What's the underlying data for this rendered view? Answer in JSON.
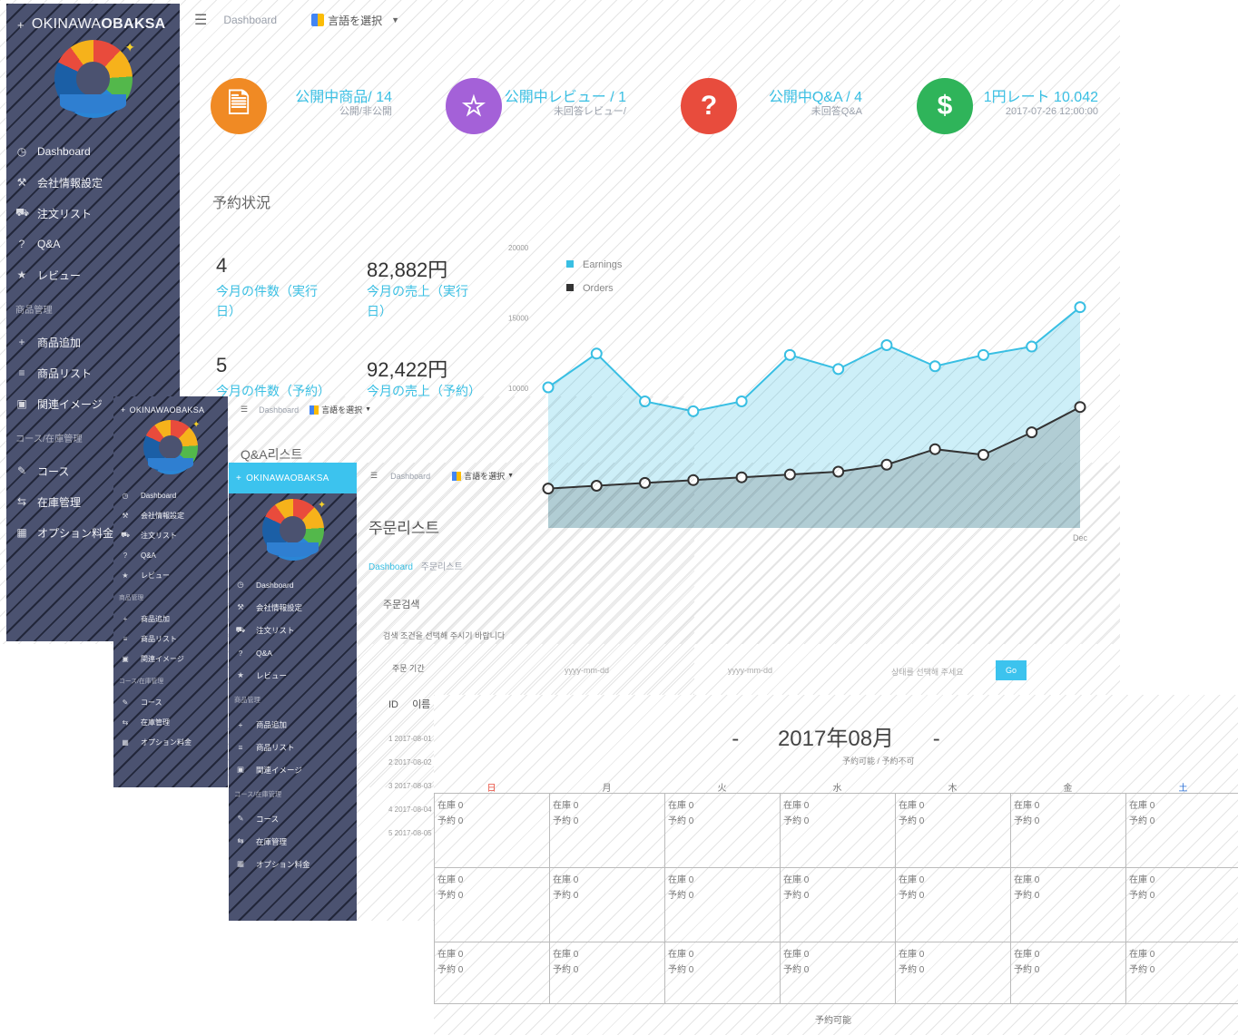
{
  "dash": {
    "brand_prefix": "OKINAWA",
    "brand_bold": "OBAKSA",
    "topbar": {
      "breadcrumb": "Dashboard",
      "language": "言語を選択"
    },
    "nav": [
      {
        "icon": "clock-icon",
        "label": "Dashboard"
      },
      {
        "icon": "wrench-icon",
        "label": "会社情報設定"
      },
      {
        "icon": "cart-icon",
        "label": "注文リスト"
      },
      {
        "icon": "question-icon",
        "label": "Q&A"
      },
      {
        "icon": "star-icon",
        "label": "レビュー"
      }
    ],
    "section_goods": "商品管理",
    "nav2": [
      {
        "icon": "plus-icon",
        "label": "商品追加"
      },
      {
        "icon": "list-icon",
        "label": "商品リスト"
      },
      {
        "icon": "image-icon",
        "label": "関連イメージ"
      }
    ],
    "section_course": "コース/在庫管理",
    "nav3": [
      {
        "icon": "pencil-icon",
        "label": "コース"
      },
      {
        "icon": "share-icon",
        "label": "在庫管理"
      },
      {
        "icon": "calendar-icon",
        "label": "オプション料金"
      }
    ],
    "stats": [
      {
        "title": "公開中商品/ 14",
        "sub": "公開/非公開",
        "color": "#f08a24",
        "glyph": "🗎"
      },
      {
        "title": "公開中レビュー / 1",
        "sub": "未回答レビュー/",
        "color": "#a461d8",
        "glyph": "☆"
      },
      {
        "title": "公開中Q&A / 4",
        "sub": "未回答Q&A",
        "color": "#e84c3d",
        "glyph": "?"
      },
      {
        "title": "1円レート 10.042",
        "sub": "2017-07-26 12:00:00",
        "color": "#2fb45a",
        "glyph": "$"
      }
    ],
    "section_title": "予約状況",
    "kpi": [
      {
        "value": "4",
        "link": "今月の件数（実行日）"
      },
      {
        "value": "82,882円",
        "link": "今月の売上（実行日）"
      },
      {
        "value": "5",
        "link": "今月の件数（予約）"
      },
      {
        "value": "92,422円",
        "link": "今月の売上（予約）"
      }
    ],
    "chart_yticks": [
      "20000",
      "15000",
      "10000"
    ],
    "chart_xlast": "Dec"
  },
  "chart_data": {
    "type": "area",
    "title": "",
    "series": [
      {
        "name": "Earnings",
        "values": [
          10000,
          12400,
          9000,
          8300,
          9000,
          12300,
          11300,
          13000,
          11500,
          12300,
          12900,
          15700
        ]
      },
      {
        "name": "Orders",
        "values": [
          2800,
          3000,
          3200,
          3400,
          3600,
          3800,
          4000,
          4500,
          5600,
          5200,
          6800,
          8600
        ]
      }
    ],
    "xlast": "Dec",
    "ylim": [
      0,
      20000
    ],
    "colors": [
      "#39bfe3",
      "#333333"
    ]
  },
  "qa": {
    "brand": "OKINAWAOBAKSA",
    "breadcrumb": "Dashboard",
    "language": "言語を選択",
    "title": "Q&A리스트",
    "nav": [
      "Dashboard",
      "会社情報設定",
      "注文リスト",
      "Q&A",
      "レビュー"
    ],
    "section_goods": "商品管理",
    "nav2": [
      "商品追加",
      "商品リスト",
      "関連イメージ"
    ],
    "section_course": "コース/在庫管理",
    "nav3": [
      "コース",
      "在庫管理",
      "オプション料金"
    ]
  },
  "order": {
    "brand": "OKINAWAOBAKSA",
    "breadcrumb": "Dashboard",
    "language": "言語を選択",
    "title": "주문리스트",
    "crumb_link": "Dashboard",
    "crumb_current": "주문리스트",
    "filter_title": "주문검색",
    "filter_help": "검색 조건을 선택해 주시기 바랍니다",
    "filter_label": "주문 기간",
    "filter_from": "yyyy-mm-dd",
    "filter_to": "yyyy-mm-dd",
    "filter_status": "상태를 선택해 주세요",
    "go": "Go",
    "table_id": "ID",
    "table_name": "이름",
    "rows": [
      "1 2017-08-01",
      "2 2017-08-02",
      "3 2017-08-03",
      "4 2017-08-04",
      "5 2017-08-05"
    ],
    "nav": [
      "Dashboard",
      "会社情報設定",
      "注文リスト",
      "Q&A",
      "レビュー"
    ],
    "section_goods": "商品管理",
    "nav2": [
      "商品追加",
      "商品リスト",
      "関連イメージ"
    ],
    "section_course": "コース/在庫管理",
    "nav3": [
      "コース",
      "在庫管理",
      "オプション料金"
    ]
  },
  "calendar": {
    "prev": "-",
    "title": "2017年08月",
    "next": "-",
    "legend": "予約可能 / 予約不可",
    "weekdays": [
      "日",
      "月",
      "火",
      "水",
      "木",
      "金",
      "土"
    ],
    "weekday_colors": [
      "#e84c3d",
      "#777",
      "#777",
      "#777",
      "#777",
      "#777",
      "#2a6fd6"
    ],
    "cell_a": "在庫 0",
    "cell_b": "予約 0",
    "footer": "予約可能"
  }
}
